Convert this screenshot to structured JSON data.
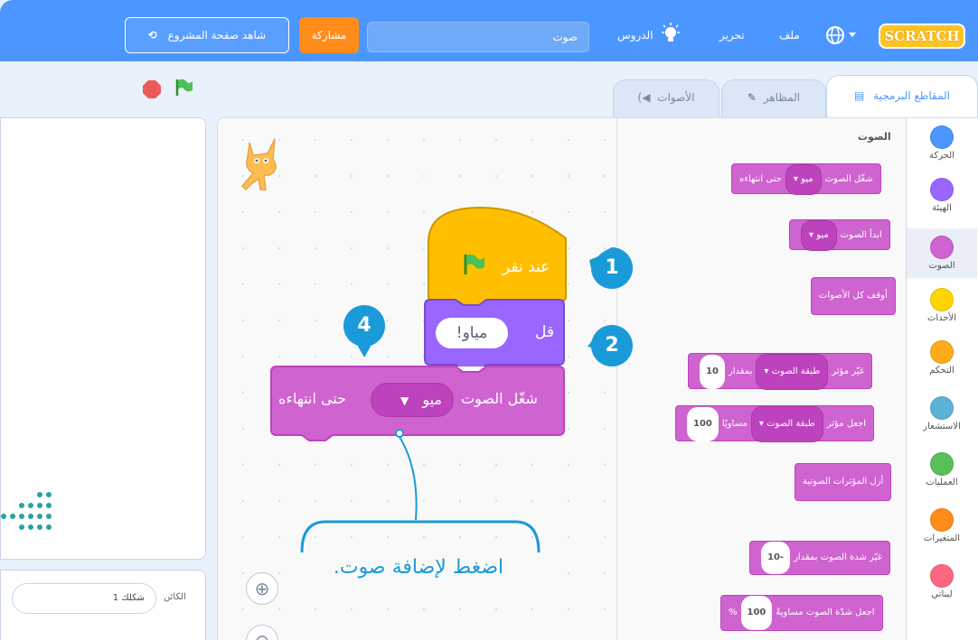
{
  "menubar": {
    "logo": "SCRATCH",
    "file": "ملف",
    "edit": "تحرير",
    "tutorials": "الدروس",
    "project_title": "صوت",
    "share": "مشاركة",
    "see_project_page": "شاهد صفحة المشروع"
  },
  "tabs": [
    {
      "label": "المقاطع البرمجية",
      "active": true
    },
    {
      "label": "المظاهر",
      "active": false
    },
    {
      "label": "الأصوات",
      "active": false
    }
  ],
  "categories": [
    {
      "label": "الحركة",
      "color": "#4c97ff"
    },
    {
      "label": "الهيئة",
      "color": "#9966ff"
    },
    {
      "label": "الصوت",
      "color": "#cf63cf"
    },
    {
      "label": "الأحداث",
      "color": "#ffd500"
    },
    {
      "label": "التحكم",
      "color": "#ffab19"
    },
    {
      "label": "الاستشعار",
      "color": "#5cb1d6"
    },
    {
      "label": "العمليات",
      "color": "#59c059"
    },
    {
      "label": "المتغيرات",
      "color": "#ff8c1a"
    },
    {
      "label": "لبناتي",
      "color": "#ff6680"
    }
  ],
  "palette": {
    "heading": "الصوت",
    "blocks": {
      "play_until_done": {
        "text": "شغّل الصوت",
        "dropdown": "ميو",
        "suffix": "حتى انتهاءه"
      },
      "start_sound": {
        "text": "ابدأ الصوت",
        "dropdown": "ميو"
      },
      "stop_all": {
        "text": "أوقف كل الأصوات"
      },
      "change_effect": {
        "text": "غيّر مؤثر",
        "dropdown": "طبقة الصوت",
        "mid": "بمقدار",
        "value": "10"
      },
      "set_effect": {
        "text": "اجعل مؤثر",
        "dropdown": "طبقة الصوت",
        "mid": "مساويًا",
        "value": "100"
      },
      "clear_effects": {
        "text": "أزل المؤثرات الصوتية"
      },
      "change_volume": {
        "text": "غيّر شدة الصوت بمقدار",
        "value": "-10"
      },
      "set_volume": {
        "text": "اجعل شدّة الصوت مساويةً",
        "value": "100",
        "unit": "%"
      }
    }
  },
  "script": {
    "hat_label": "عند نقر",
    "say_label": "قل",
    "say_value": "مياو!",
    "play_label": "شغّل الصوت",
    "play_dropdown": "ميو",
    "play_suffix": "حتى انتهاءه"
  },
  "callouts": {
    "n1": "1",
    "n2": "2",
    "n4": "4",
    "hint": "اضغط لإضافة صوت."
  },
  "sprite_panel": {
    "sprite_label": "الكائن",
    "sprite_name": "شكلك 1"
  },
  "zoom": {
    "in_symbol": "⊕",
    "out_symbol": "⊖"
  },
  "colors": {
    "menubar": "#4c97ff",
    "events": "#ffbf00",
    "looks": "#9966ff",
    "sound": "#cf63cf",
    "callout": "#1a9ad8"
  }
}
